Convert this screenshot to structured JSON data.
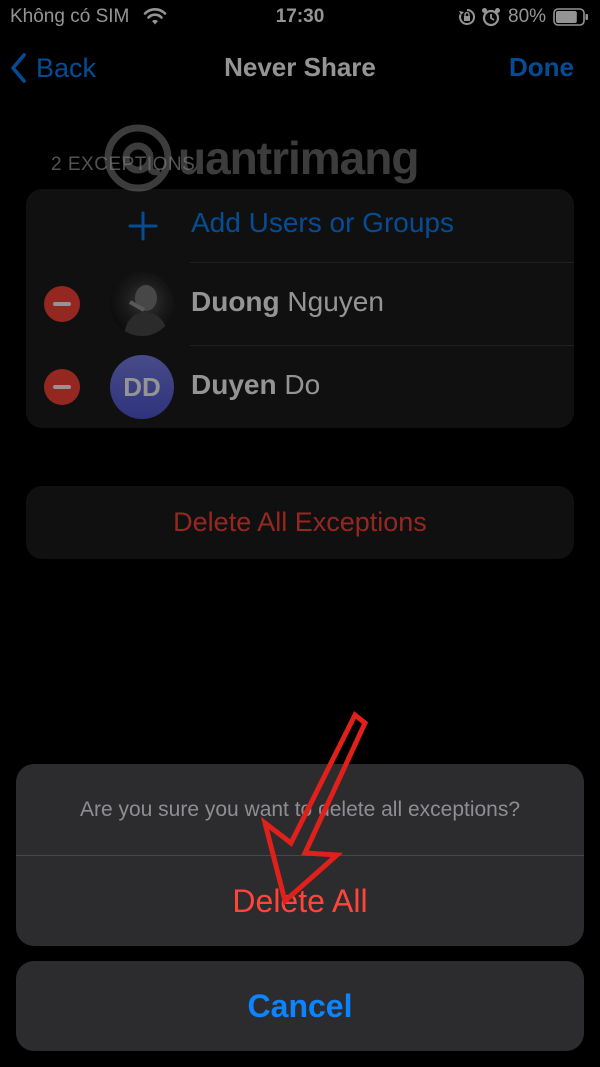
{
  "status_bar": {
    "carrier": "Không có SIM",
    "time": "17:30",
    "battery": "80%",
    "battery_level": 0.8,
    "icons": [
      "wifi-icon",
      "rotation-lock-icon",
      "alarm-icon",
      "battery-icon"
    ]
  },
  "nav": {
    "back_label": "Back",
    "title": "Never Share",
    "done_label": "Done"
  },
  "exceptions": {
    "header": "2 EXCEPTIONS",
    "add_label": "Add Users or Groups",
    "contacts": [
      {
        "first": "Duong",
        "last": "Nguyen",
        "avatar": "photo"
      },
      {
        "first": "Duyen",
        "last": "Do",
        "avatar": "initials",
        "initials": "DD"
      }
    ]
  },
  "delete_all_exceptions_label": "Delete All Exceptions",
  "action_sheet": {
    "message": "Are you sure you want to delete all exceptions?",
    "destructive_label": "Delete All",
    "cancel_label": "Cancel"
  },
  "watermark": {
    "text": "uantrimang"
  },
  "colors": {
    "accent": "#0a84ff",
    "destructive": "#ff453a",
    "cell_background": "#1c1c1e",
    "sheet_background": "#2c2c2e",
    "annotation_arrow": "#e0201b"
  }
}
